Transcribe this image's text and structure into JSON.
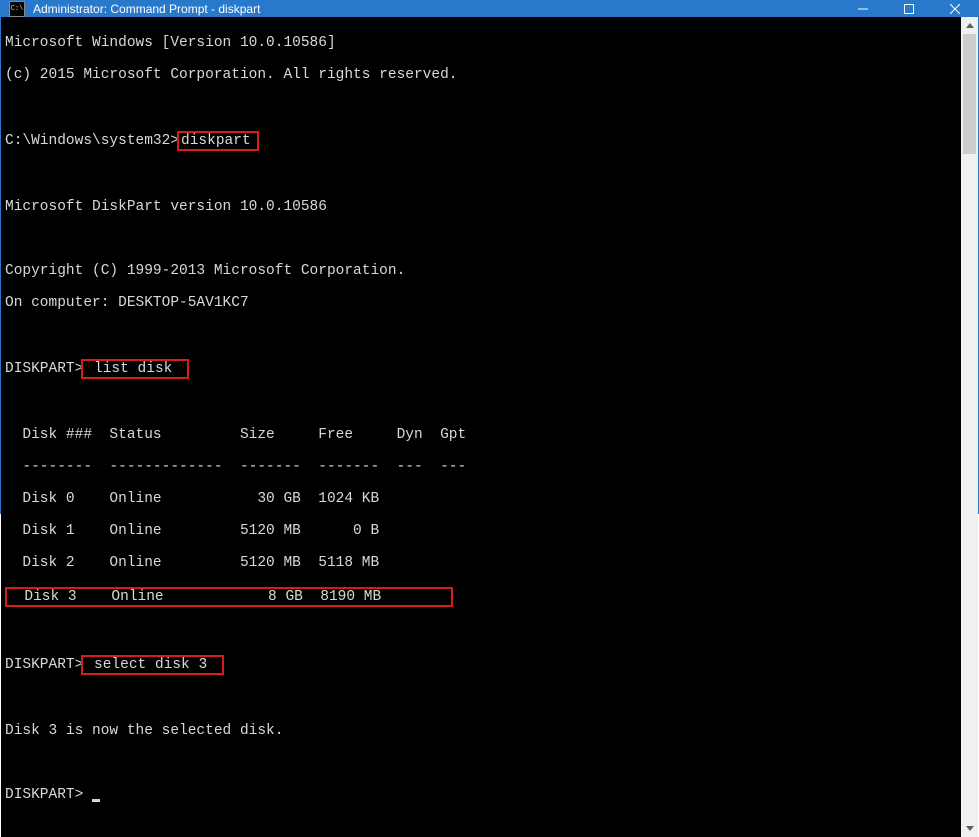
{
  "window": {
    "title": "Administrator: Command Prompt - diskpart"
  },
  "terminal": {
    "lines": {
      "l1": "Microsoft Windows [Version 10.0.10586]",
      "l2": "(c) 2015 Microsoft Corporation. All rights reserved.",
      "l3": "",
      "prompt1_prefix": "C:\\Windows\\system32>",
      "cmd1": "diskpart",
      "l5": "",
      "l6": "Microsoft DiskPart version 10.0.10586",
      "l7": "",
      "l8": "Copyright (C) 1999-2013 Microsoft Corporation.",
      "l9": "On computer: DESKTOP-5AV1KC7",
      "l10": "",
      "prompt2_prefix": "DISKPART>",
      "cmd2": " list disk ",
      "l12": "",
      "table_header": "  Disk ###  Status         Size     Free     Dyn  Gpt",
      "table_sep": "  --------  -------------  -------  -------  ---  ---",
      "row0": "  Disk 0    Online           30 GB  1024 KB",
      "row1": "  Disk 1    Online         5120 MB      0 B",
      "row2": "  Disk 2    Online         5120 MB  5118 MB",
      "row3": "  Disk 3    Online            8 GB  8190 MB        ",
      "l18": "",
      "prompt3_prefix": "DISKPART>",
      "cmd3": " select disk 3 ",
      "l20": "",
      "l21": "Disk 3 is now the selected disk.",
      "l22": "",
      "prompt4_prefix": "DISKPART> "
    }
  },
  "highlights": {
    "color": "#d91a1a"
  }
}
